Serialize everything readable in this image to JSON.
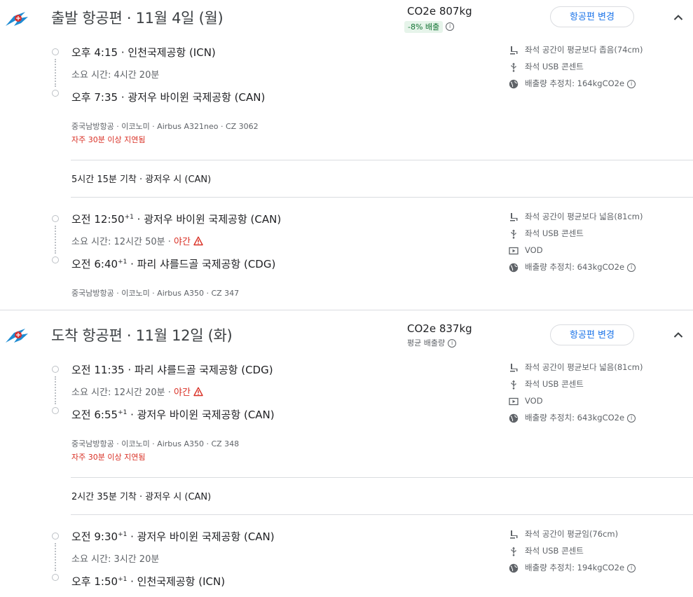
{
  "colors": {
    "accent": "#1a73e8",
    "warning": "#d93025",
    "positive": "#137333",
    "logo_blue": "#1e8bd2",
    "logo_red": "#d62f2f"
  },
  "outbound": {
    "title": "출발 항공편 · 11월 4일 (월)",
    "co2": "CO2e 807kg",
    "co2_badge": "-8% 배출",
    "change_label": "항공편 변경",
    "seg1": {
      "dep_time": "오후 4:15",
      "dep_sup": "",
      "dep_airport": "인천국제공항 (ICN)",
      "duration": "소요 시간: 4시간 20분",
      "arr_time": "오후 7:35",
      "arr_sup": "",
      "arr_airport": "광저우 바이윈 국제공항 (CAN)",
      "meta": "중국남방항공 · 이코노미 · Airbus A321neo · CZ 3062",
      "delay": "자주 30분 이상 지연됨",
      "amenities": [
        "좌석 공간이 평균보다 좁음(74cm)",
        "좌석 USB 콘센트",
        "배출량 추정치: 164kgCO2e"
      ]
    },
    "layover": "5시간 15분 기착 · 광저우 시 (CAN)",
    "seg2": {
      "dep_time": "오전 12:50",
      "dep_sup": "+1",
      "dep_airport": "광저우 바이윈 국제공항 (CAN)",
      "duration": "소요 시간: 12시간 50분",
      "night": "야간",
      "arr_time": "오전 6:40",
      "arr_sup": "+1",
      "arr_airport": "파리 샤를드골 국제공항 (CDG)",
      "meta": "중국남방항공 · 이코노미 · Airbus A350 · CZ 347",
      "amenities": [
        "좌석 공간이 평균보다 넓음(81cm)",
        "좌석 USB 콘센트",
        "VOD",
        "배출량 추정치: 643kgCO2e"
      ]
    }
  },
  "return": {
    "title": "도착 항공편 · 11월 12일 (화)",
    "co2": "CO2e 837kg",
    "co2_avg": "평균 배출량",
    "change_label": "항공편 변경",
    "seg1": {
      "dep_time": "오전 11:35",
      "dep_sup": "",
      "dep_airport": "파리 샤를드골 국제공항 (CDG)",
      "duration": "소요 시간: 12시간 20분",
      "night": "야간",
      "arr_time": "오전 6:55",
      "arr_sup": "+1",
      "arr_airport": "광저우 바이윈 국제공항 (CAN)",
      "meta": "중국남방항공 · 이코노미 · Airbus A350 · CZ 348",
      "delay": "자주 30분 이상 지연됨",
      "amenities": [
        "좌석 공간이 평균보다 넓음(81cm)",
        "좌석 USB 콘센트",
        "VOD",
        "배출량 추정치: 643kgCO2e"
      ]
    },
    "layover": "2시간 35분 기착 · 광저우 시 (CAN)",
    "seg2": {
      "dep_time": "오전 9:30",
      "dep_sup": "+1",
      "dep_airport": "광저우 바이윈 국제공항 (CAN)",
      "duration": "소요 시간: 3시간 20분",
      "arr_time": "오후 1:50",
      "arr_sup": "+1",
      "arr_airport": "인천국제공항 (ICN)",
      "amenities": [
        "좌석 공간이 평균임(76cm)",
        "좌석 USB 콘센트",
        "배출량 추정치: 194kgCO2e"
      ]
    }
  }
}
